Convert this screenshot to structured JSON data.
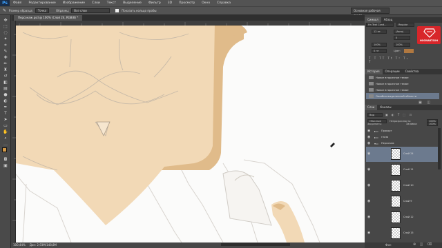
{
  "menu": {
    "logo": "Ps",
    "items": [
      "Файл",
      "Редактирование",
      "Изображение",
      "Слои",
      "Текст",
      "Выделение",
      "Фильтр",
      "3D",
      "Просмотр",
      "Окно",
      "Справка"
    ]
  },
  "options": {
    "sample_size_label": "Размер образца:",
    "sample_size_value": "Точка",
    "sample_label": "Образец:",
    "sample_value": "Все слои",
    "show_ring_label": "Показать кольцо пробы",
    "workspace": "Основная рабочая среда"
  },
  "document_tab": "Персонаж.psd @ 100% (Слой 24, RGB/8) *",
  "status": {
    "zoom": "100,44%",
    "doc": "Док: 2,93М/148,8М"
  },
  "panels": {
    "top_tabs": [
      "Символ",
      "Абзац"
    ],
    "character": {
      "font": "Hn Text Cond...",
      "style": "Regular",
      "size": "12 пт",
      "leading": "(Авто)",
      "tracking": "0",
      "scale_v": "100%",
      "scale_h": "100%",
      "baseline": "0 пт",
      "color_label": "Цвет:"
    },
    "promo": "HOGWARTSOH",
    "history_tabs": [
      "История",
      "Операции",
      "Свойства"
    ],
    "history": [
      "Новое вторичное темое",
      "Новое вторичное темое",
      "Новое вторичное темое",
      "Ошибка выделенной области"
    ],
    "layer_tabs": [
      "Слои",
      "Каналы"
    ],
    "layer_controls": {
      "kind": "Вид",
      "blend": "Обычные",
      "opacity_label": "Непрозрачность:",
      "opacity": "100%",
      "lock_label": "Закрепить:",
      "fill_label": "Заливка:",
      "fill": "100%"
    },
    "groups": [
      {
        "label": "Пракорт"
      },
      {
        "label": "глаза"
      },
      {
        "label": "Персонаж"
      }
    ],
    "layers": [
      {
        "label": "Слой 24",
        "selected": true
      },
      {
        "label": "Слой 11",
        "selected": false
      },
      {
        "label": "Слой 10",
        "selected": false
      },
      {
        "label": "Слой 9",
        "selected": false
      },
      {
        "label": "Слой 12",
        "selected": false
      },
      {
        "label": "Слой 15",
        "selected": false
      },
      {
        "label": "Фон",
        "selected": false
      }
    ]
  },
  "colors": {
    "skin": "#f2d9b6",
    "skin_shadow": "#e0bb8a",
    "sketch_line": "#bfb4a6",
    "accent_red": "#d8262a"
  }
}
